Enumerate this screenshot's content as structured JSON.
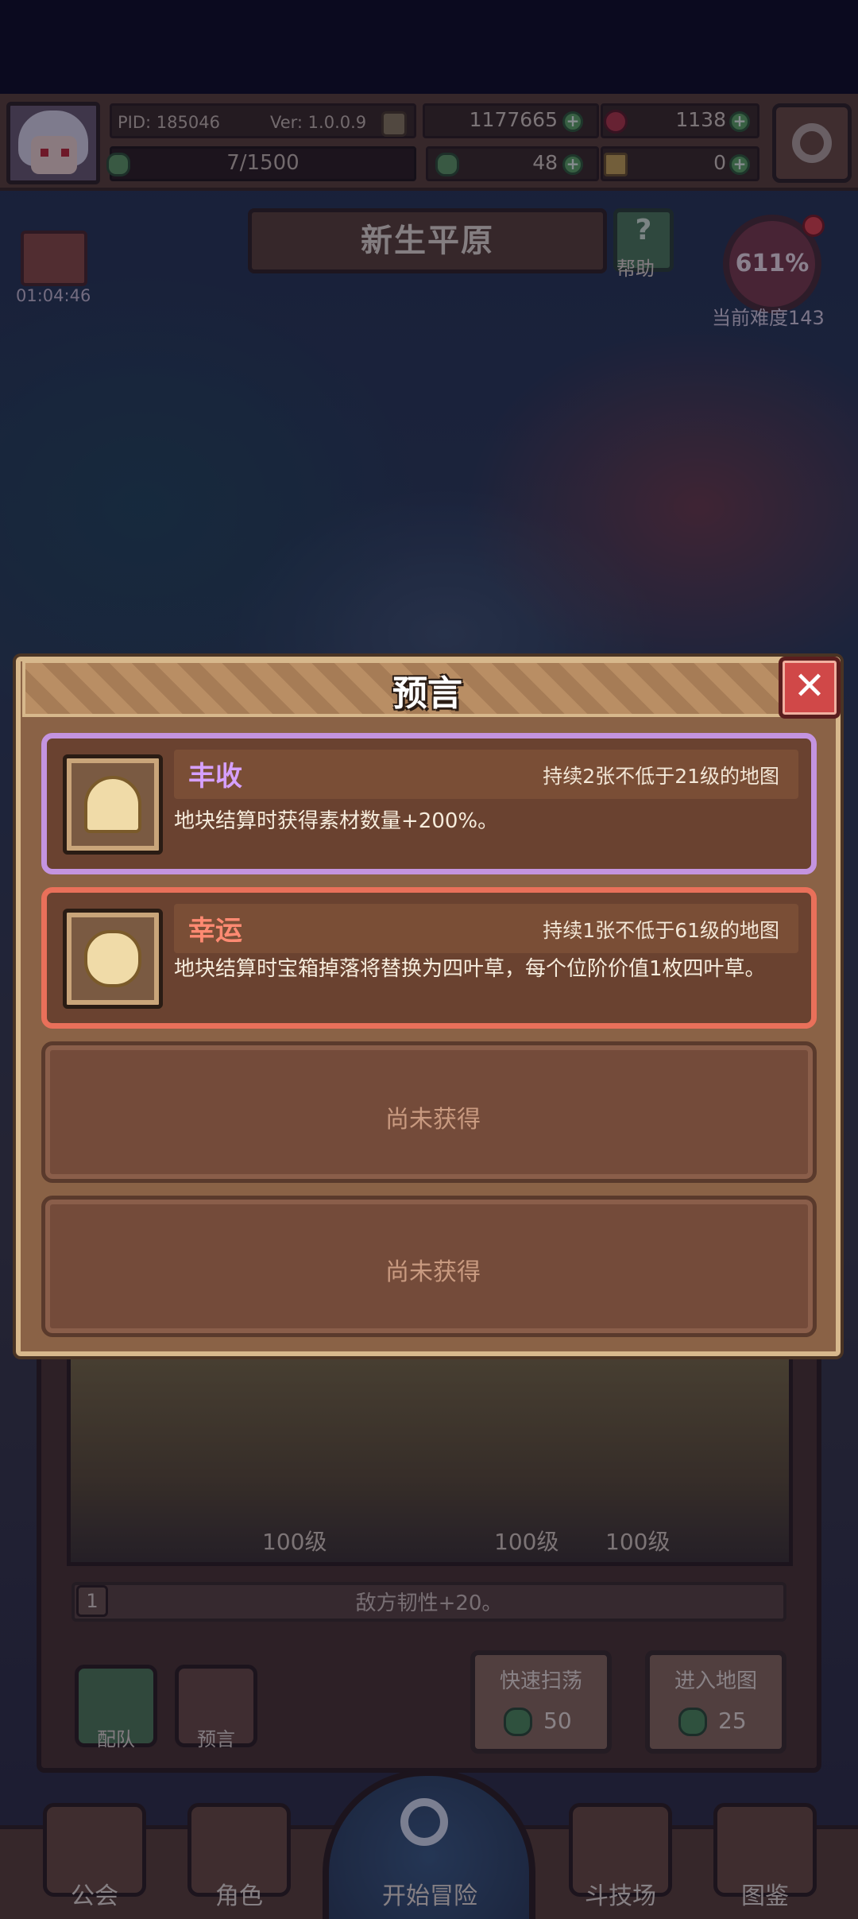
{
  "topbar": {
    "pid": "PID: 185046",
    "version": "Ver: 1.0.0.9",
    "gold": "1177665",
    "red_gem": "1138",
    "exp": "7/1500",
    "clover": "48",
    "key": "0"
  },
  "map": {
    "title": "新生平原",
    "help_label": "帮助",
    "help_symbol": "?",
    "gift_timer": "01:04:46",
    "difficulty_percent": "611%",
    "difficulty_label": "当前难度143"
  },
  "modal": {
    "title": "预言",
    "close_symbol": "✕",
    "prophecies": [
      {
        "name": "丰收",
        "condition": "持续2张不低于21级的地图",
        "description": "地块结算时获得素材数量+200%。",
        "icon": "wheat-icon",
        "rarity_color": "#c494e0"
      },
      {
        "name": "幸运",
        "condition": "持续1张不低于61级的地图",
        "description": "地块结算时宝箱掉落将替换为四叶草，每个位阶价值1枚四叶草。",
        "icon": "four-leaf-clover-icon",
        "rarity_color": "#e9705a"
      }
    ],
    "empty_slots": [
      "尚未获得",
      "尚未获得"
    ]
  },
  "stage": {
    "levels": [
      "100级",
      "100级",
      "100级"
    ],
    "slot_number": "1",
    "effect": "敌方韧性+20。"
  },
  "actions": {
    "team_label": "配队",
    "prophecy_label": "预言",
    "quick_sweep_label": "快速扫荡",
    "quick_sweep_cost": "50",
    "enter_map_label": "进入地图",
    "enter_map_cost": "25"
  },
  "nav": {
    "guild": "公会",
    "character": "角色",
    "start": "开始冒险",
    "arena": "斗技场",
    "codex": "图鉴"
  }
}
